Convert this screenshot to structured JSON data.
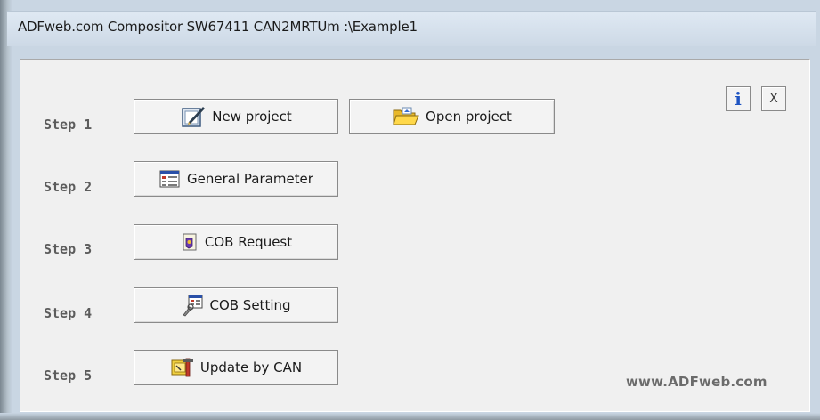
{
  "window": {
    "title": "ADFweb.com Compositor SW67411 CAN2MRTUm :\\Example1"
  },
  "toolbar": {
    "info_icon": "info-icon",
    "info_glyph": "i",
    "close_glyph": "X"
  },
  "steps": [
    {
      "label": "Step 1"
    },
    {
      "label": "Step 2"
    },
    {
      "label": "Step 3"
    },
    {
      "label": "Step 4"
    },
    {
      "label": "Step 5"
    }
  ],
  "buttons": {
    "new_project": {
      "label": "New project",
      "icon": "new-project-icon"
    },
    "open_project": {
      "label": "Open project",
      "icon": "open-folder-icon"
    },
    "general_parameter": {
      "label": "General Parameter",
      "icon": "parameter-table-icon"
    },
    "cob_request": {
      "label": "COB Request",
      "icon": "cob-request-icon"
    },
    "cob_setting": {
      "label": "COB Setting",
      "icon": "cob-setting-icon"
    },
    "update_by_can": {
      "label": "Update by CAN",
      "icon": "update-tools-icon"
    }
  },
  "footer": {
    "website": "www.ADFweb.com"
  },
  "colors": {
    "frame": "#c9d6e3",
    "client_bg": "#f0f0f0",
    "step_text": "#5c5c5c",
    "info_blue": "#1f54c2"
  }
}
